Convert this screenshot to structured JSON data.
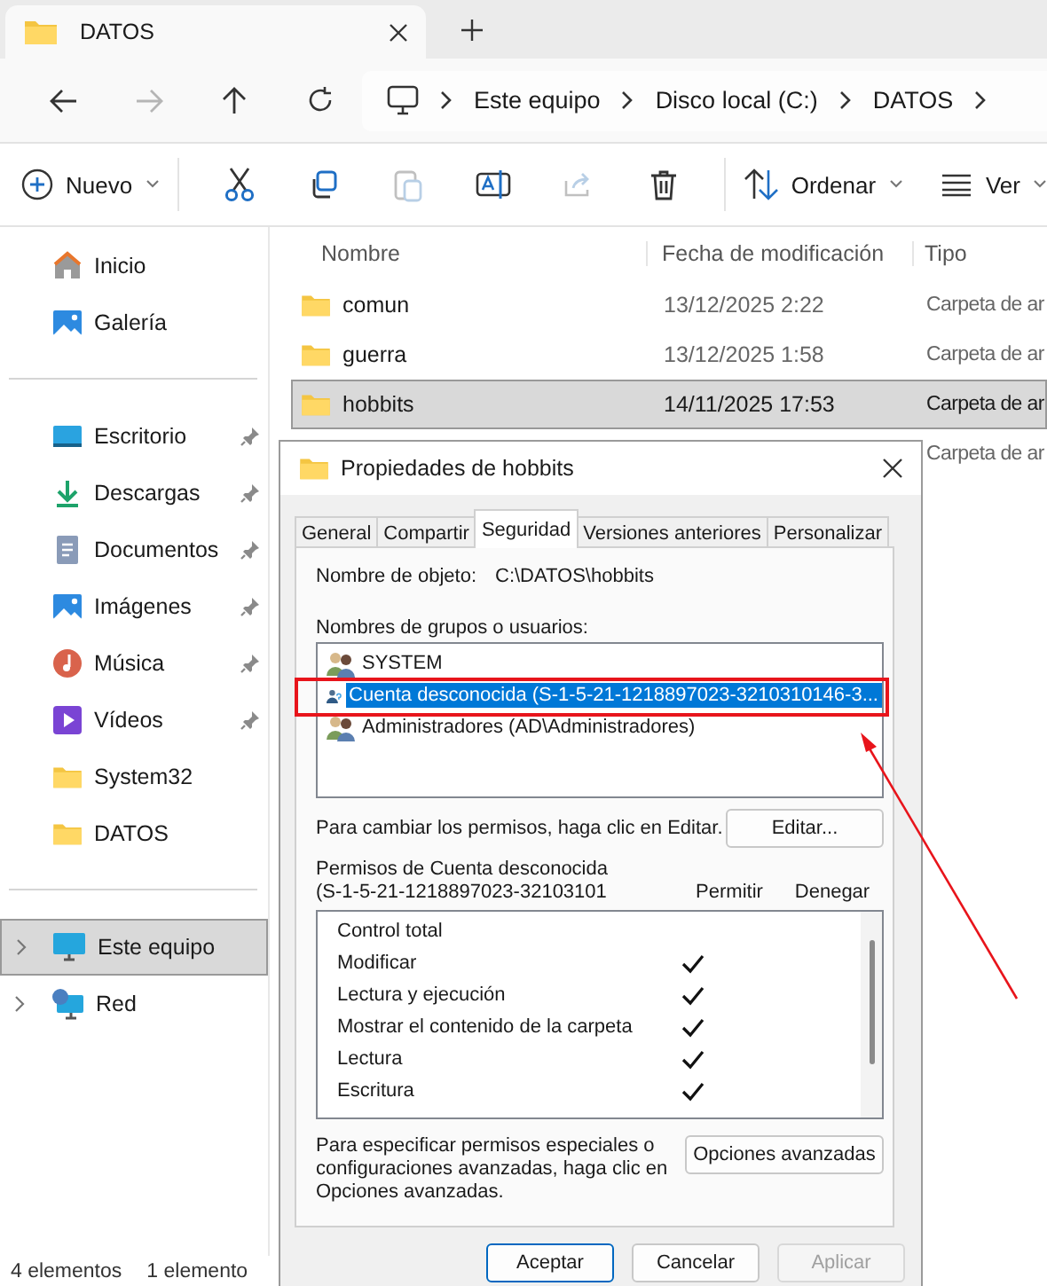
{
  "window_tab": {
    "title": "DATOS"
  },
  "address_bar": {
    "breadcrumbs": [
      "Este equipo",
      "Disco local (C:)",
      "DATOS"
    ]
  },
  "toolbar": {
    "new_label": "Nuevo",
    "sort_label": "Ordenar",
    "view_label": "Ver",
    "actions": [
      {
        "kind": "cut",
        "disabled": false
      },
      {
        "kind": "copy",
        "disabled": false
      },
      {
        "kind": "paste",
        "disabled": true
      },
      {
        "kind": "rename",
        "disabled": false
      },
      {
        "kind": "share",
        "disabled": true
      },
      {
        "kind": "delete",
        "disabled": false
      }
    ]
  },
  "sidebar": {
    "sections": [
      {
        "items": [
          {
            "label": "Inicio",
            "kind": "home",
            "pinned": false,
            "selected": false,
            "expandable": false
          },
          {
            "label": "Galería",
            "kind": "gallery",
            "pinned": false,
            "selected": false,
            "expandable": false
          }
        ]
      },
      {
        "items": [
          {
            "label": "Escritorio",
            "kind": "desktop",
            "pinned": true,
            "selected": false,
            "expandable": false
          },
          {
            "label": "Descargas",
            "kind": "downloads",
            "pinned": true,
            "selected": false,
            "expandable": false
          },
          {
            "label": "Documentos",
            "kind": "documents",
            "pinned": true,
            "selected": false,
            "expandable": false
          },
          {
            "label": "Imágenes",
            "kind": "pictures",
            "pinned": true,
            "selected": false,
            "expandable": false
          },
          {
            "label": "Música",
            "kind": "music",
            "pinned": true,
            "selected": false,
            "expandable": false
          },
          {
            "label": "Vídeos",
            "kind": "videos",
            "pinned": true,
            "selected": false,
            "expandable": false
          },
          {
            "label": "System32",
            "kind": "folder",
            "pinned": false,
            "selected": false,
            "expandable": false
          },
          {
            "label": "DATOS",
            "kind": "folder",
            "pinned": false,
            "selected": false,
            "expandable": false
          }
        ]
      },
      {
        "items": [
          {
            "label": "Este equipo",
            "kind": "pc",
            "pinned": false,
            "selected": true,
            "expandable": true
          },
          {
            "label": "Red",
            "kind": "network",
            "pinned": false,
            "selected": false,
            "expandable": true
          }
        ]
      }
    ]
  },
  "file_list": {
    "columns": [
      "Nombre",
      "Fecha de modificación",
      "Tipo"
    ],
    "rows": [
      {
        "name": "comun",
        "date": "13/12/2025 2:22",
        "type": "Carpeta de ar",
        "selected": false
      },
      {
        "name": "guerra",
        "date": "13/12/2025 1:58",
        "type": "Carpeta de ar",
        "selected": false
      },
      {
        "name": "hobbits",
        "date": "14/11/2025 17:53",
        "type": "Carpeta de ar",
        "selected": true
      },
      {
        "type": "Carpeta de ar",
        "selected": false
      }
    ]
  },
  "status_bar": [
    "4 elementos",
    "1 elemento"
  ],
  "dialog": {
    "title": "Propiedades de hobbits",
    "tabs": [
      {
        "label": "General",
        "selected": false
      },
      {
        "label": "Compartir",
        "selected": false
      },
      {
        "label": "Seguridad",
        "selected": true
      },
      {
        "label": "Versiones anteriores",
        "selected": false
      },
      {
        "label": "Personalizar",
        "selected": false
      }
    ],
    "object_label": "Nombre de objeto:",
    "object_value": "C:\\DATOS\\hobbits",
    "users_label": "Nombres de grupos o usuarios:",
    "users": [
      {
        "name": "SYSTEM",
        "kind": "group",
        "selected": false
      },
      {
        "name": "Cuenta desconocida (S-1-5-21-1218897023-3210310146-3...",
        "kind": "unknown",
        "selected": true
      },
      {
        "name": "Administradores (AD\\Administradores)",
        "kind": "group",
        "selected": false
      }
    ],
    "edit_hint": "Para cambiar los permisos, haga clic en Editar.",
    "edit_button": "Editar...",
    "permissions_label": [
      "Permisos de Cuenta desconocida",
      "(S-1-5-21-1218897023-32103101"
    ],
    "permission_columns": [
      "Permitir",
      "Denegar"
    ],
    "permissions": [
      {
        "name": "Control total",
        "allow": false,
        "deny": false
      },
      {
        "name": "Modificar",
        "allow": true,
        "deny": false
      },
      {
        "name": "Lectura y ejecución",
        "allow": true,
        "deny": false
      },
      {
        "name": "Mostrar el contenido de la carpeta",
        "allow": true,
        "deny": false
      },
      {
        "name": "Lectura",
        "allow": true,
        "deny": false
      },
      {
        "name": "Escritura",
        "allow": true,
        "deny": false
      }
    ],
    "advanced_hint": "Para especificar permisos especiales o configuraciones avanzadas, haga clic en Opciones avanzadas.",
    "advanced_button": "Opciones avanzadas",
    "buttons": [
      {
        "label": "Aceptar",
        "default": true,
        "disabled": false
      },
      {
        "label": "Cancelar",
        "default": false,
        "disabled": false
      },
      {
        "label": "Aplicar",
        "default": false,
        "disabled": true
      }
    ]
  }
}
